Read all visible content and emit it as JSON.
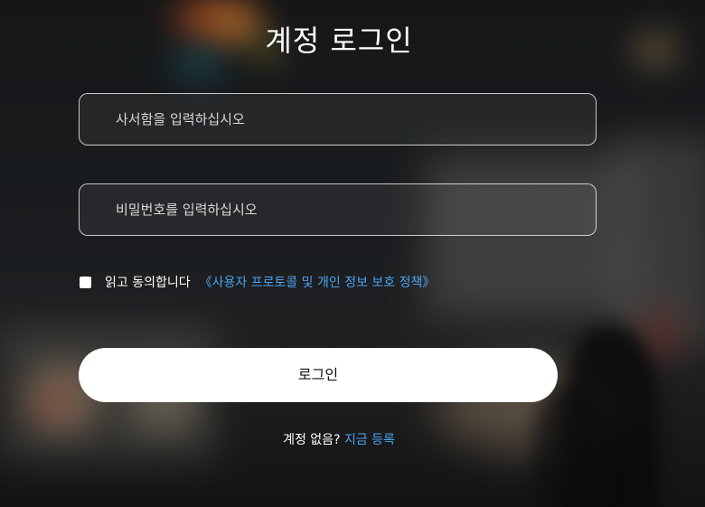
{
  "form": {
    "title": "계정 로그인",
    "username": {
      "placeholder": "사서함을 입력하십시오",
      "value": ""
    },
    "password": {
      "placeholder": "비밀번호를 입력하십시오",
      "value": ""
    },
    "agreement": {
      "checked": false,
      "text": "읽고 동의합니다",
      "link_text": "《사용자 프로토콜 및 개인 정보 보호 정책》"
    },
    "login_label": "로그인",
    "signup": {
      "prompt": "계정 없음?",
      "link_text": "지금 등록"
    }
  },
  "colors": {
    "link": "#4aa3f0",
    "button_bg": "#ffffff",
    "text": "#ffffff"
  }
}
